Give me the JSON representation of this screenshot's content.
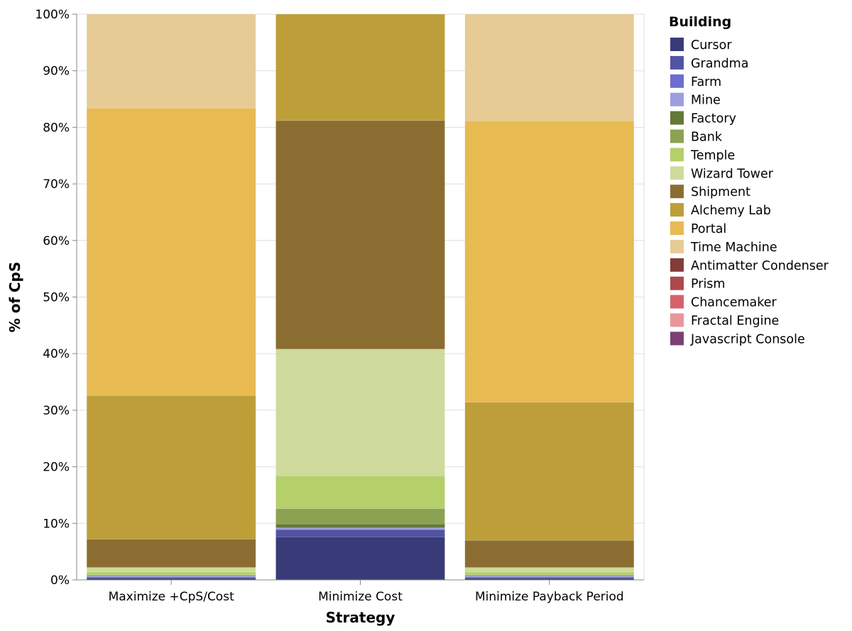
{
  "chart_data": {
    "type": "bar",
    "stacked": true,
    "normalized": true,
    "title": "",
    "xlabel": "Strategy",
    "ylabel": "% of CpS",
    "ylim": [
      0,
      100
    ],
    "y_ticks": [
      "0%",
      "10%",
      "20%",
      "30%",
      "40%",
      "50%",
      "60%",
      "70%",
      "80%",
      "90%",
      "100%"
    ],
    "grid": true,
    "categories": [
      "Maximize +CpS/Cost",
      "Minimize Cost",
      "Minimize Payback Period"
    ],
    "legend": {
      "title": "Building",
      "placement": "right"
    },
    "series": [
      {
        "name": "Cursor",
        "color": "#393b79",
        "values": [
          0.3,
          7.6,
          0.3
        ]
      },
      {
        "name": "Grandma",
        "color": "#5254a3",
        "values": [
          0.2,
          1.3,
          0.2
        ]
      },
      {
        "name": "Farm",
        "color": "#6b6ecf",
        "values": [
          0.1,
          0.0,
          0.1
        ]
      },
      {
        "name": "Mine",
        "color": "#9c9ede",
        "values": [
          0.1,
          0.3,
          0.1
        ]
      },
      {
        "name": "Factory",
        "color": "#637939",
        "values": [
          0.05,
          0.7,
          0.05
        ]
      },
      {
        "name": "Bank",
        "color": "#8ca252",
        "values": [
          0.15,
          2.7,
          0.15
        ]
      },
      {
        "name": "Temple",
        "color": "#b5cf6b",
        "values": [
          0.5,
          5.8,
          0.5
        ]
      },
      {
        "name": "Wizard Tower",
        "color": "#cedb9c",
        "values": [
          0.8,
          22.4,
          0.8
        ]
      },
      {
        "name": "Shipment",
        "color": "#8c6d31",
        "values": [
          5.0,
          40.4,
          4.8
        ]
      },
      {
        "name": "Alchemy Lab",
        "color": "#bd9e39",
        "values": [
          25.4,
          18.8,
          24.5
        ]
      },
      {
        "name": "Portal",
        "color": "#e7ba52",
        "values": [
          50.8,
          0.0,
          49.9
        ]
      },
      {
        "name": "Time Machine",
        "color": "#e7cb94",
        "values": [
          16.6,
          0.0,
          18.9
        ]
      },
      {
        "name": "Antimatter Condenser",
        "color": "#843c39",
        "values": [
          0,
          0,
          0
        ]
      },
      {
        "name": "Prism",
        "color": "#ad494a",
        "values": [
          0,
          0,
          0
        ]
      },
      {
        "name": "Chancemaker",
        "color": "#d6616b",
        "values": [
          0,
          0,
          0
        ]
      },
      {
        "name": "Fractal Engine",
        "color": "#e7969c",
        "values": [
          0,
          0,
          0
        ]
      },
      {
        "name": "Javascript Console",
        "color": "#7b4173",
        "values": [
          0,
          0,
          0
        ]
      }
    ]
  }
}
